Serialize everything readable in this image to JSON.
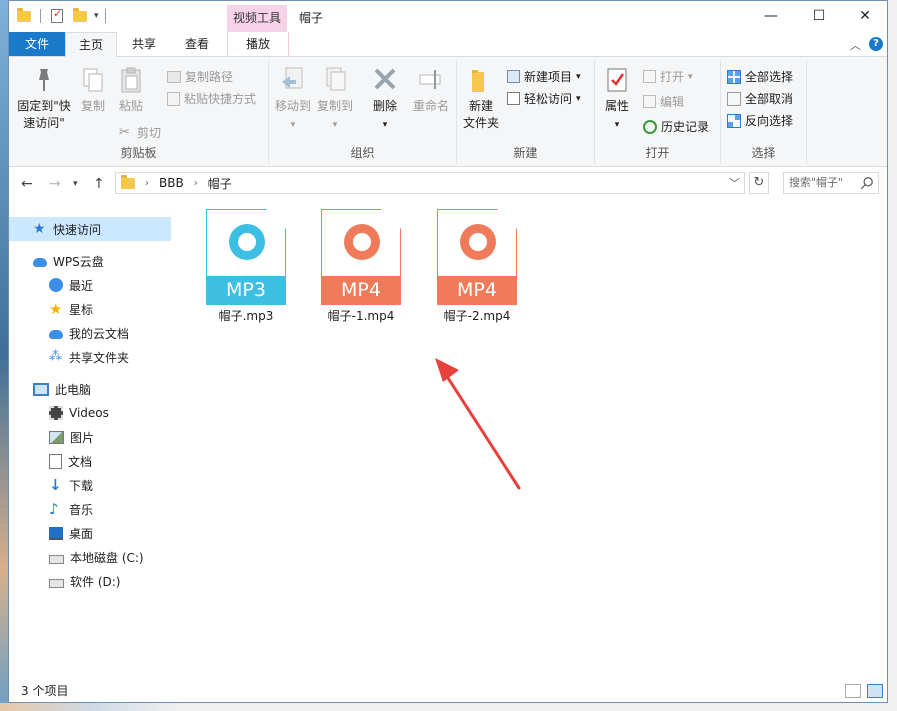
{
  "window": {
    "title": "帽子",
    "context_tab_group": "视频工具",
    "controls": {
      "minimize": "—",
      "maximize": "☐",
      "close": "✕"
    },
    "accent": "#1979ca"
  },
  "ribbon_tabs": [
    "文件",
    "主页",
    "共享",
    "查看",
    "播放"
  ],
  "ribbon": {
    "clipboard": {
      "label": "剪贴板",
      "pin": "固定到\"快速访问\"",
      "pin_line1": "固定到\"快",
      "pin_line2": "速访问\"",
      "copy": "复制",
      "paste": "粘贴",
      "copy_path": "复制路径",
      "paste_shortcut": "粘贴快捷方式",
      "cut": "剪切"
    },
    "organize": {
      "label": "组织",
      "move_to": "移动到",
      "copy_to": "复制到",
      "delete": "删除",
      "rename": "重命名"
    },
    "new": {
      "label": "新建",
      "new_folder_line1": "新建",
      "new_folder_line2": "文件夹",
      "new_item": "新建项目",
      "easy_access": "轻松访问"
    },
    "open": {
      "label": "打开",
      "properties": "属性",
      "open": "打开",
      "edit": "编辑",
      "history": "历史记录"
    },
    "select": {
      "label": "选择",
      "select_all": "全部选择",
      "select_none": "全部取消",
      "invert": "反向选择"
    }
  },
  "address": {
    "crumbs": [
      "BBB",
      "帽子"
    ],
    "search_placeholder": "搜索\"帽子\""
  },
  "nav_pane": {
    "quick_access": "快速访问",
    "items": [
      "WPS云盘",
      "最近",
      "星标",
      "我的云文档",
      "共享文件夹"
    ],
    "this_pc": "此电脑",
    "pc_items": [
      "Videos",
      "图片",
      "文档",
      "下载",
      "音乐",
      "桌面",
      "本地磁盘 (C:)",
      "软件 (D:)"
    ]
  },
  "files": [
    {
      "name": "帽子.mp3",
      "type": "MP3",
      "color": "#3cbfe3"
    },
    {
      "name": "帽子-1.mp4",
      "type": "MP4",
      "color": "#f07b5b"
    },
    {
      "name": "帽子-2.mp4",
      "type": "MP4",
      "color": "#f07b5b"
    }
  ],
  "status": {
    "count": "3 个项目"
  },
  "annotation_color": "#e8403a"
}
